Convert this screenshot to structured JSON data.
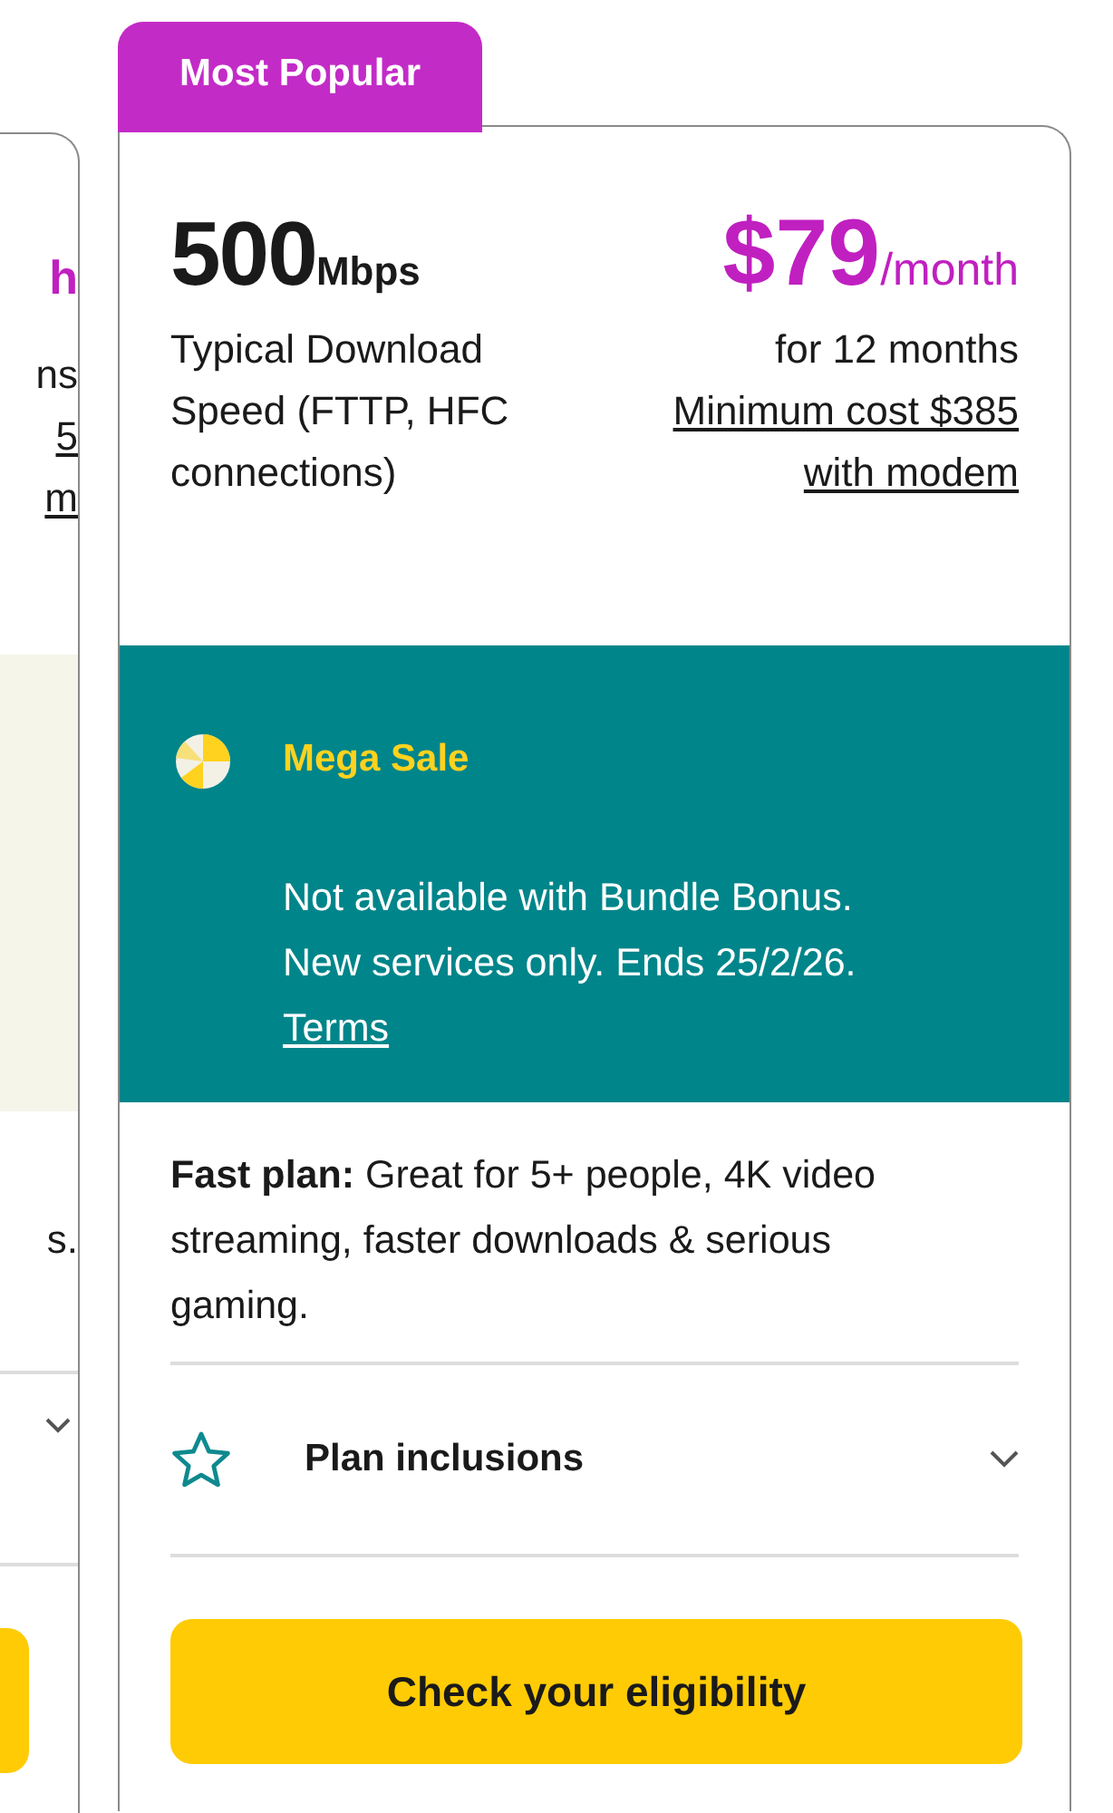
{
  "side_card": {
    "price_fragment": "h",
    "term_lines": [
      {
        "text": "ns",
        "underlined": false
      },
      {
        "text": "5",
        "underlined": true
      },
      {
        "text": "m",
        "underlined": true
      }
    ],
    "description_fragment": "s."
  },
  "plan": {
    "badge": "Most Popular",
    "speed": "500",
    "speed_unit": "Mbps",
    "price": "$79",
    "price_unit": "/month",
    "speed_note": "Typical Download Speed (FTTP, HFC connections)",
    "term": "for 12 months",
    "min_cost_lines": [
      "Minimum cost $385",
      "with modem"
    ],
    "promo": {
      "title": "Mega Sale",
      "text": "Not available with Bundle Bonus. New services only. Ends 25/2/26.",
      "link": "Terms"
    },
    "description": "**Fast plan:** Great for 5+ people, 4K video streaming, faster downloads & serious gaming.",
    "inclusions": {
      "label": "Plan inclusions",
      "expanded": false
    },
    "button": "Check your eligibility"
  }
}
